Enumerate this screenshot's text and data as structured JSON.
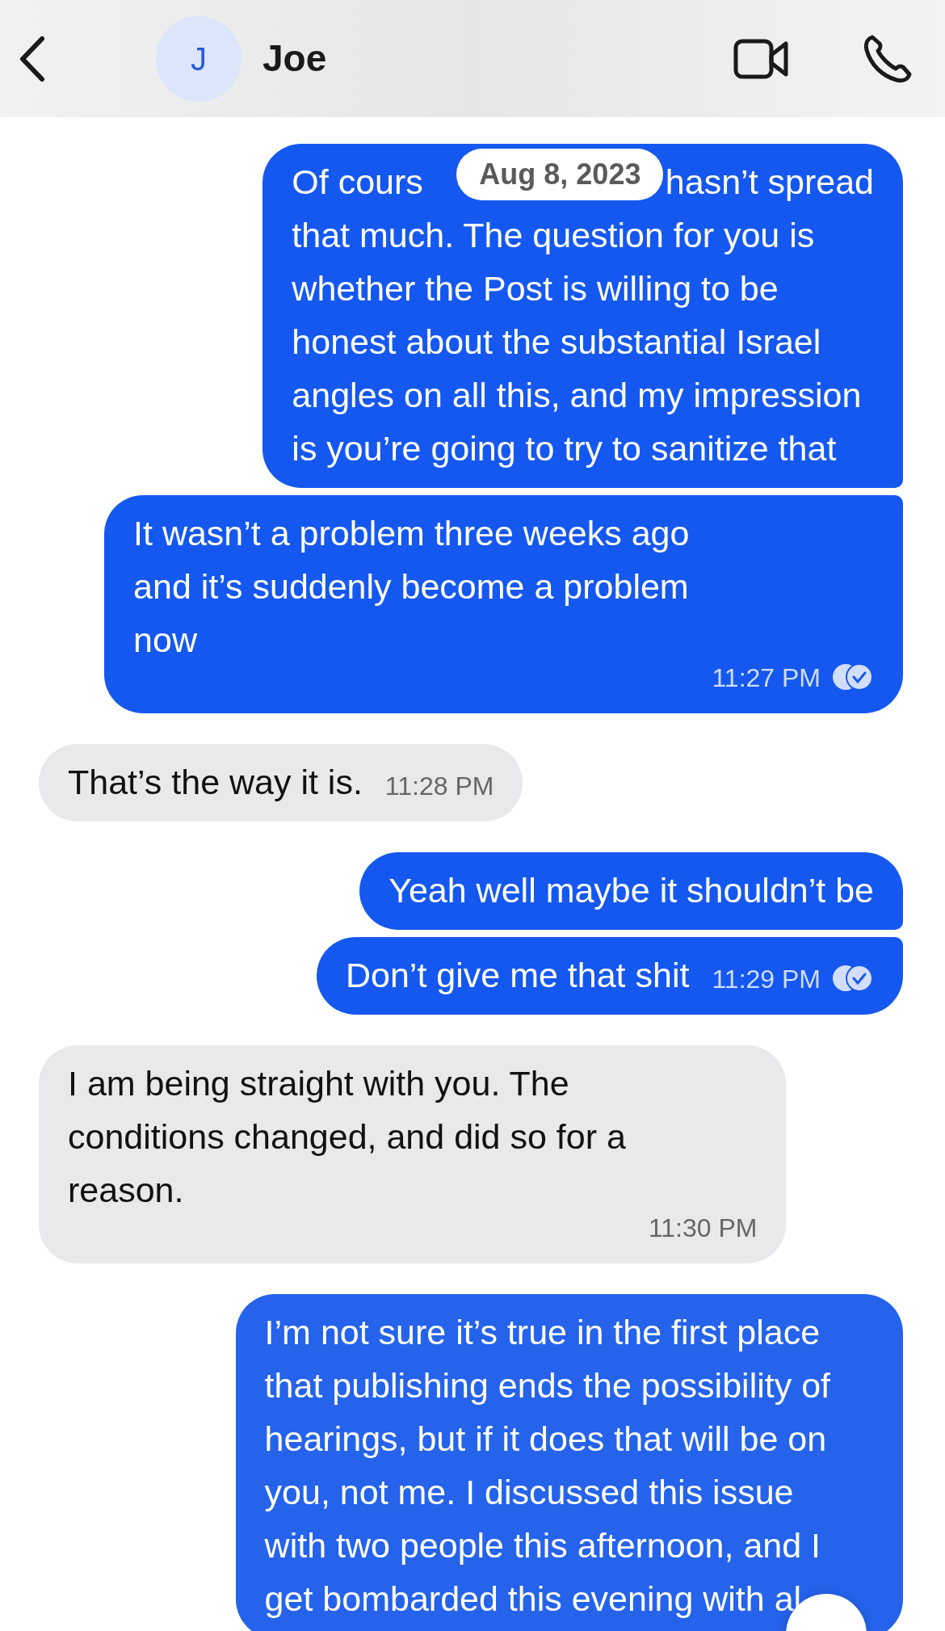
{
  "header": {
    "avatar_letter": "J",
    "name": "Joe"
  },
  "date_pill": "Aug 8, 2023",
  "messages": [
    {
      "kind": "sent",
      "text_before_pill": "Of cours",
      "text_after_pill": "hasn’t spread",
      "text": "that much. The question for you is\nwhether the Post is willing to be\nhonest about the substantial Israel\nangles on all this, and my impression\nis you’re going to try to sanitize that"
    },
    {
      "kind": "sent",
      "text": "It wasn’t a problem three weeks ago\nand it’s suddenly become a problem\nnow",
      "time": "11:27 PM",
      "read": true
    },
    {
      "kind": "received",
      "text": "That’s the way it is.",
      "time": "11:28 PM"
    },
    {
      "kind": "sent",
      "text": "Yeah well maybe it shouldn’t be"
    },
    {
      "kind": "sent",
      "text": "Don’t give me that shit",
      "time": "11:29 PM",
      "read": true
    },
    {
      "kind": "received",
      "text": "I am being straight with you. The\nconditions changed, and did so for a\nreason.",
      "time": "11:30 PM"
    },
    {
      "kind": "sent",
      "text": "I’m not sure it’s true in the first place\nthat publishing ends the possibility of\nhearings, but if it does that will be on\nyou, not me. I discussed this issue\nwith two people this afternoon, and I\nget bombarded this evening with al"
    }
  ]
}
